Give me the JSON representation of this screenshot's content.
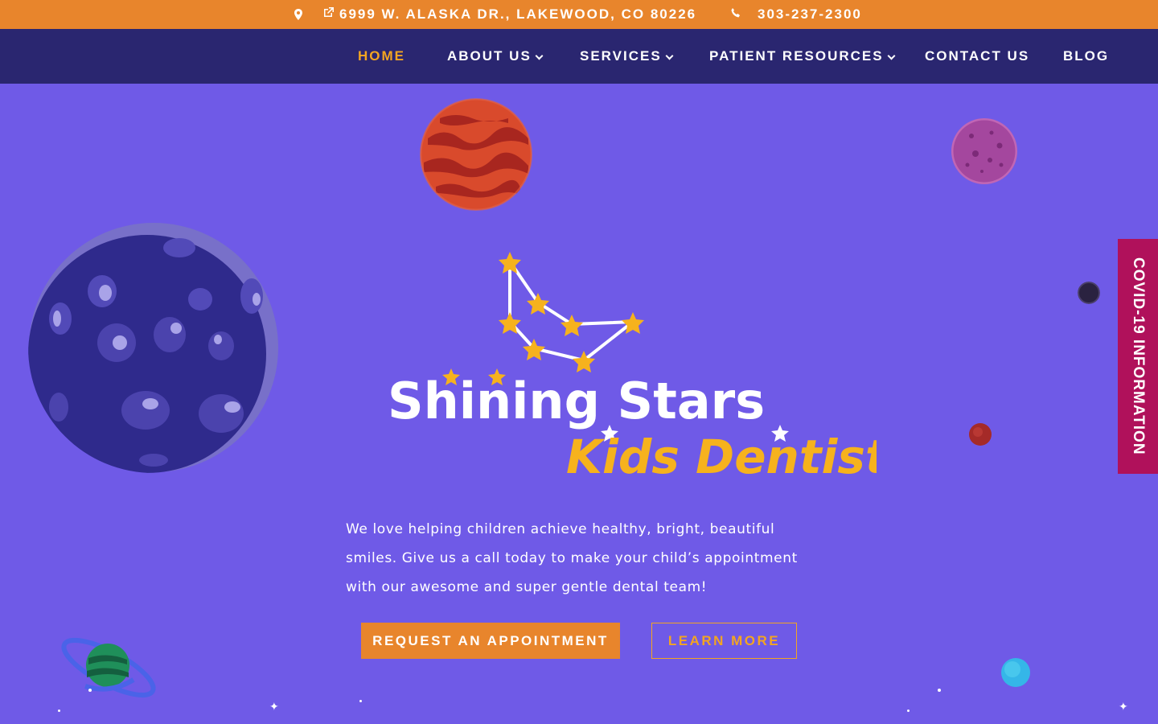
{
  "topbar": {
    "address": "6999 W. ALASKA DR., LAKEWOOD, CO 80226",
    "phone": "303-237-2300"
  },
  "nav": {
    "items": [
      {
        "label": "HOME",
        "active": true
      },
      {
        "label": "ABOUT US",
        "dropdown": true
      },
      {
        "label": "SERVICES",
        "dropdown": true
      },
      {
        "label": "PATIENT RESOURCES",
        "dropdown": true
      },
      {
        "label": "CONTACT US"
      },
      {
        "label": "BLOG"
      }
    ]
  },
  "hero": {
    "logo_line1": "Shining Stars",
    "logo_line2": "Kids Dentistry",
    "tagline": "We love helping children achieve healthy, bright, beautiful smiles. Give us a call today to make your child’s appointment with our awesome and super gentle dental team!",
    "primary_button": "REQUEST AN APPOINTMENT",
    "secondary_button": "LEARN MORE"
  },
  "covid_tab": "COVID-19 INFORMATION",
  "colors": {
    "background": "#6f5ae7",
    "topbar": "#e8852c",
    "nav": "#2a2670",
    "accent": "#f3a521",
    "covid": "#b0115b"
  }
}
